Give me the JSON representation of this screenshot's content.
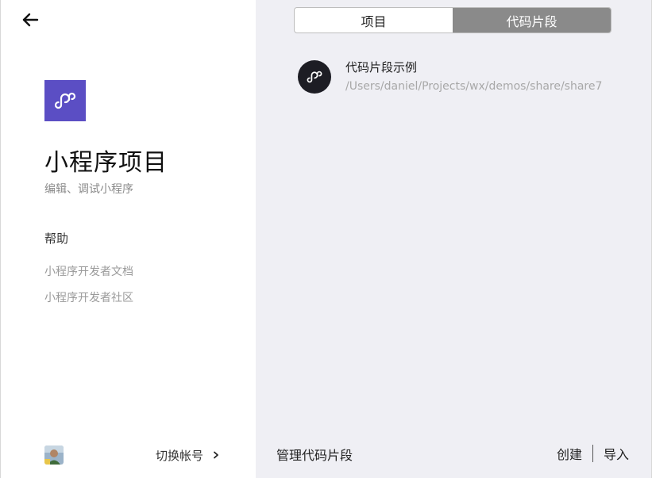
{
  "left": {
    "title": "小程序项目",
    "subtitle": "编辑、调试小程序",
    "help": {
      "heading": "帮助",
      "links": [
        "小程序开发者文档",
        "小程序开发者社区"
      ]
    },
    "account": {
      "switch_label": "切换帐号"
    }
  },
  "right": {
    "tabs": [
      {
        "label": "项目",
        "active": false
      },
      {
        "label": "代码片段",
        "active": true
      }
    ],
    "snippets": [
      {
        "name": "代码片段示例",
        "path": "/Users/daniel/Projects/wx/demos/share/share7"
      }
    ],
    "bottom": {
      "manage_label": "管理代码片段",
      "create_label": "创建",
      "import_label": "导入"
    }
  },
  "colors": {
    "brand": "#5b4ec4",
    "active_tab": "#8a8a8a",
    "panel_bg": "#efeff4"
  },
  "icons": {
    "back": "arrow-left-icon",
    "logo": "miniprogram-logo-icon",
    "chevron": "chevron-right-icon"
  }
}
